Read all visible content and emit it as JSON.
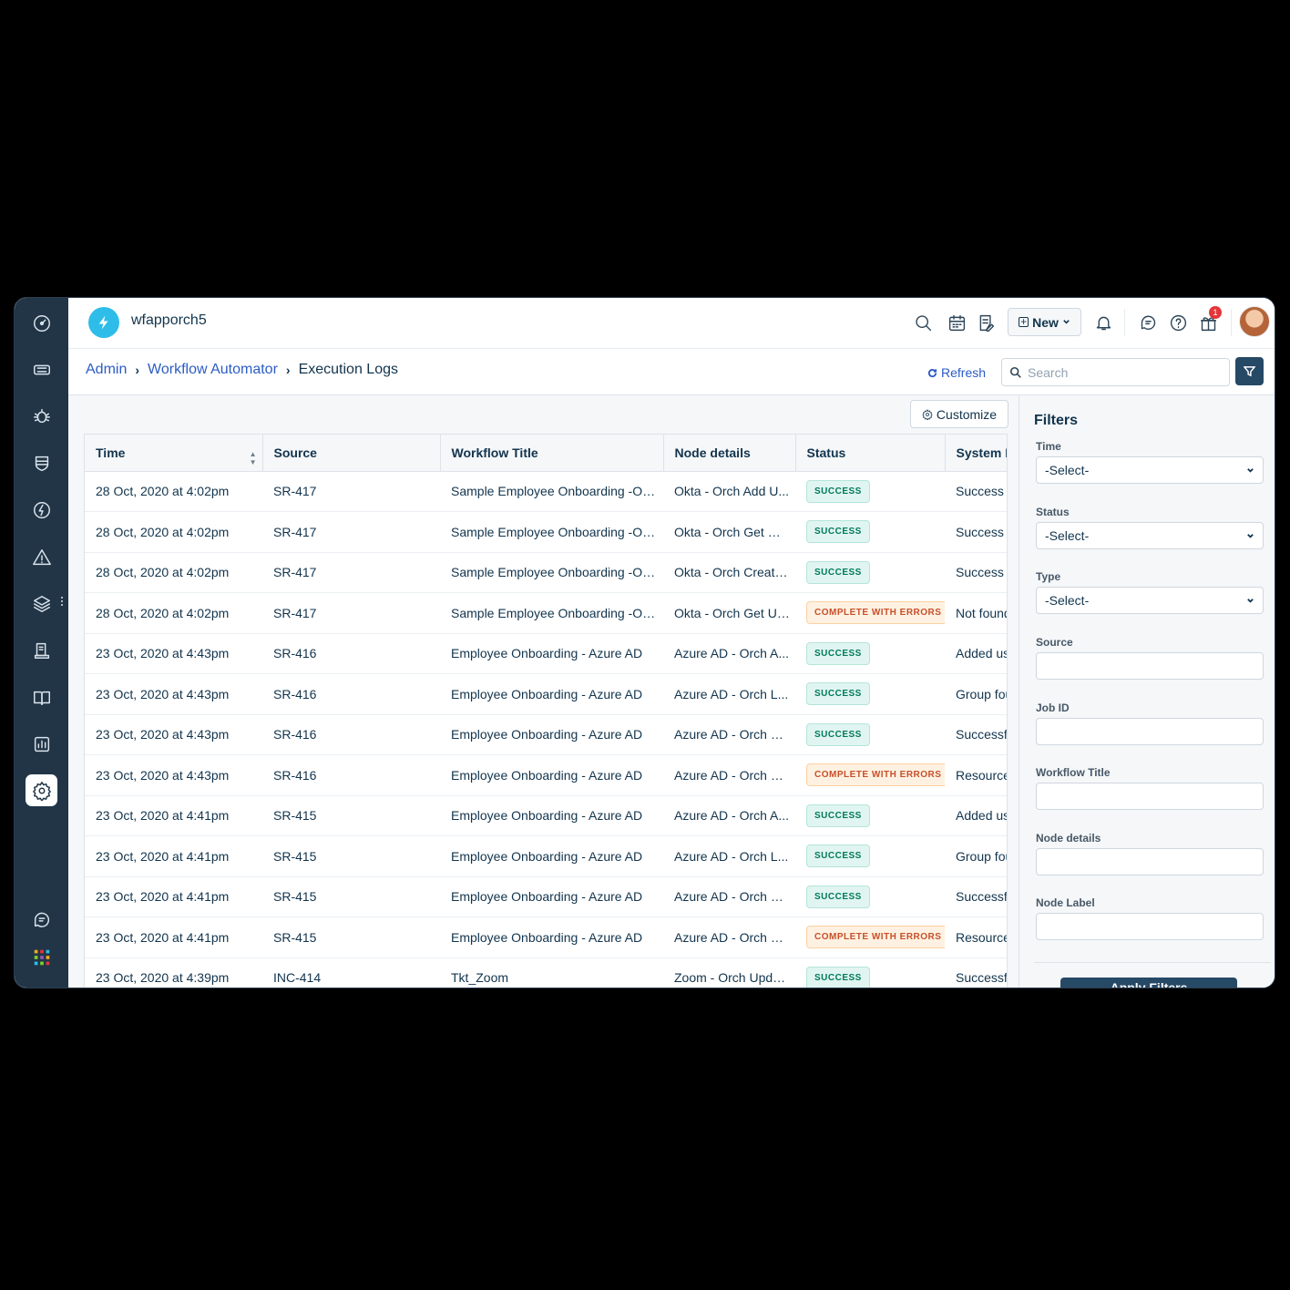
{
  "app": {
    "title": "wfapporch5"
  },
  "topbar": {
    "new_label": "New",
    "gift_badge_count": "1"
  },
  "breadcrumb": {
    "items": [
      "Admin",
      "Workflow Automator"
    ],
    "current": "Execution Logs"
  },
  "toolbar": {
    "refresh_label": "Refresh",
    "search_placeholder": "Search",
    "customize_label": "Customize"
  },
  "table": {
    "columns": [
      "Time",
      "Source",
      "Workflow Title",
      "Node details",
      "Status",
      "System M"
    ],
    "rows": [
      [
        "28 Oct, 2020 at 4:02pm",
        "SR-417",
        "Sample Employee Onboarding -Okt...",
        "Okta - Orch Add U...",
        "SUCCESS",
        "Success"
      ],
      [
        "28 Oct, 2020 at 4:02pm",
        "SR-417",
        "Sample Employee Onboarding -Okt...",
        "Okta - Orch Get Gr...",
        "SUCCESS",
        "Success"
      ],
      [
        "28 Oct, 2020 at 4:02pm",
        "SR-417",
        "Sample Employee Onboarding -Okt...",
        "Okta - Orch Create...",
        "SUCCESS",
        "Success"
      ],
      [
        "28 Oct, 2020 at 4:02pm",
        "SR-417",
        "Sample Employee Onboarding -Okt...",
        "Okta - Orch Get Us...",
        "COMPLETE WITH ERRORS",
        "Not found"
      ],
      [
        "23 Oct, 2020 at 4:43pm",
        "SR-416",
        "Employee Onboarding - Azure AD",
        "Azure AD - Orch A...",
        "SUCCESS",
        "Added us"
      ],
      [
        "23 Oct, 2020 at 4:43pm",
        "SR-416",
        "Employee Onboarding - Azure AD",
        "Azure AD - Orch L...",
        "SUCCESS",
        "Group fou"
      ],
      [
        "23 Oct, 2020 at 4:43pm",
        "SR-416",
        "Employee Onboarding - Azure AD",
        "Azure AD - Orch Cr...",
        "SUCCESS",
        "Successf"
      ],
      [
        "23 Oct, 2020 at 4:43pm",
        "SR-416",
        "Employee Onboarding - Azure AD",
        "Azure AD - Orch G...",
        "COMPLETE WITH ERRORS",
        "Resource"
      ],
      [
        "23 Oct, 2020 at 4:41pm",
        "SR-415",
        "Employee Onboarding - Azure AD",
        "Azure AD - Orch A...",
        "SUCCESS",
        "Added us"
      ],
      [
        "23 Oct, 2020 at 4:41pm",
        "SR-415",
        "Employee Onboarding - Azure AD",
        "Azure AD - Orch L...",
        "SUCCESS",
        "Group fou"
      ],
      [
        "23 Oct, 2020 at 4:41pm",
        "SR-415",
        "Employee Onboarding - Azure AD",
        "Azure AD - Orch Cr...",
        "SUCCESS",
        "Successf"
      ],
      [
        "23 Oct, 2020 at 4:41pm",
        "SR-415",
        "Employee Onboarding - Azure AD",
        "Azure AD - Orch G...",
        "COMPLETE WITH ERRORS",
        "Resource"
      ],
      [
        "23 Oct, 2020 at 4:39pm",
        "INC-414",
        "Tkt_Zoom",
        "Zoom - Orch Upda...",
        "SUCCESS",
        "Successf"
      ]
    ]
  },
  "filters": {
    "title": "Filters",
    "time_label": "Time",
    "time_value": "-Select-",
    "status_label": "Status",
    "status_value": "-Select-",
    "type_label": "Type",
    "type_value": "-Select-",
    "source_label": "Source",
    "job_id_label": "Job ID",
    "workflow_title_label": "Workflow Title",
    "node_details_label": "Node details",
    "node_label_label": "Node Label",
    "apply_label": "Apply Filters"
  },
  "colors": {
    "sidebar": "#213547",
    "link": "#2c5cc5",
    "success_bg": "#e0f5f1",
    "success_text": "#00795b",
    "error_bg": "#fef1e1",
    "error_text": "#c7502a",
    "primary_button": "#264966"
  },
  "icons": {
    "sidebar": [
      "dashboard-icon",
      "tickets-icon",
      "problems-icon",
      "changes-icon",
      "releases-icon",
      "alerts-icon",
      "assets-icon",
      "contracts-icon",
      "solutions-icon",
      "reports-icon",
      "admin-gear-icon",
      "chat-icon",
      "apps-grid-icon"
    ],
    "topbar": [
      "search-icon",
      "calendar-icon",
      "todo-icon",
      "bell-icon",
      "chat-icon",
      "help-icon",
      "gift-icon"
    ]
  }
}
